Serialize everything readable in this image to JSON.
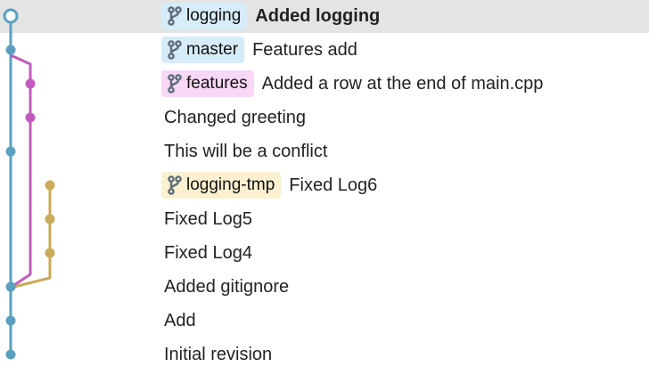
{
  "colors": {
    "master_lane": "#5aa0c0",
    "features_lane": "#c25bbd",
    "logging_tmp_lane": "#c9aa5a",
    "selection": "#e4e4e4",
    "badge_logging": "#d6ecf8",
    "badge_master": "#d6ecf8",
    "badge_features": "#f9d7f6",
    "badge_logging_tmp": "#fbf0cf",
    "icon": "#5f6f7a"
  },
  "commits": [
    {
      "message": "Added logging",
      "branch": "logging",
      "badge_color": "#d6ecf8",
      "bold": true,
      "selected": true,
      "lane": 0
    },
    {
      "message": "Features add",
      "branch": "master",
      "badge_color": "#d6ecf8",
      "bold": false,
      "selected": false,
      "lane": 0
    },
    {
      "message": "Added a row at the end of main.cpp",
      "branch": "features",
      "badge_color": "#f9d7f6",
      "bold": false,
      "selected": false,
      "lane": 1
    },
    {
      "message": "Changed greeting",
      "branch": "",
      "badge_color": "",
      "bold": false,
      "selected": false,
      "lane": 1
    },
    {
      "message": "This will be a conflict",
      "branch": "",
      "badge_color": "",
      "bold": false,
      "selected": false,
      "lane": 0
    },
    {
      "message": "Fixed Log6",
      "branch": "logging-tmp",
      "badge_color": "#fbf0cf",
      "bold": false,
      "selected": false,
      "lane": 2
    },
    {
      "message": "Fixed Log5",
      "branch": "",
      "badge_color": "",
      "bold": false,
      "selected": false,
      "lane": 2
    },
    {
      "message": "Fixed Log4",
      "branch": "",
      "badge_color": "",
      "bold": false,
      "selected": false,
      "lane": 2
    },
    {
      "message": "Added gitignore",
      "branch": "",
      "badge_color": "",
      "bold": false,
      "selected": false,
      "lane": 0
    },
    {
      "message": "Add",
      "branch": "",
      "badge_color": "",
      "bold": false,
      "selected": false,
      "lane": 0
    },
    {
      "message": "Initial revision",
      "branch": "",
      "badge_color": "",
      "bold": false,
      "selected": false,
      "lane": 0
    }
  ]
}
